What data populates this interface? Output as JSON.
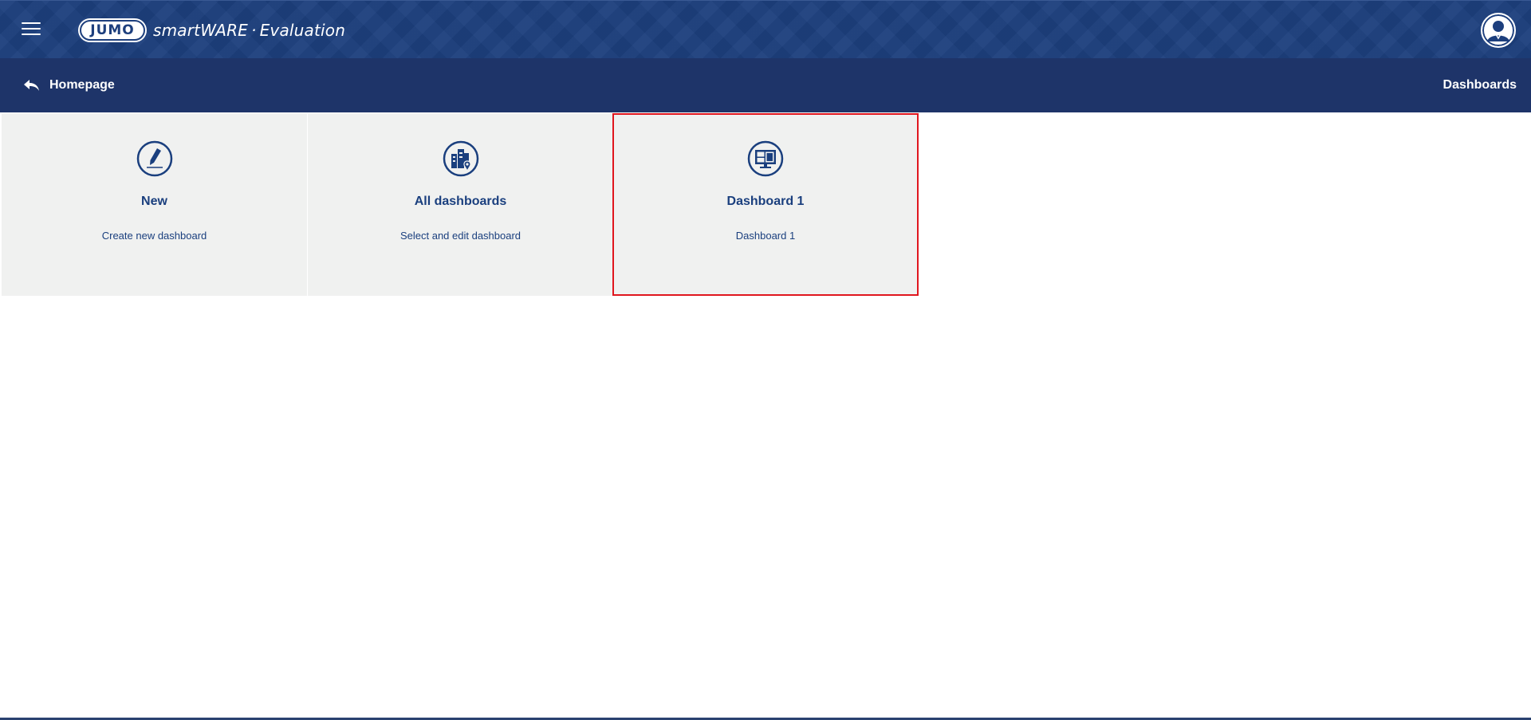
{
  "header": {
    "menu_icon": "hamburger-menu-icon",
    "logo_text": "JUMO",
    "product_name": "smartWARE",
    "product_dot": "·",
    "product_module": "Evaluation",
    "user_icon": "user-avatar-icon"
  },
  "navbar": {
    "back_label": "Homepage",
    "back_icon": "back-arrow-icon",
    "section_title": "Dashboards"
  },
  "tiles": [
    {
      "title": "New",
      "subtitle": "Create new dashboard",
      "icon": "pencil-edit-icon"
    },
    {
      "title": "All dashboards",
      "subtitle": "Select and edit dashboard",
      "icon": "buildings-location-icon"
    },
    {
      "title": "Dashboard 1",
      "subtitle": "Dashboard 1",
      "icon": "monitor-dashboard-icon"
    }
  ],
  "colors": {
    "header_bg": "#1d3f7d",
    "navbar_bg": "#1e3469",
    "tile_bg": "#f0f1f0",
    "tile_text": "#1a3f7e",
    "selected_border": "#e0161e"
  }
}
